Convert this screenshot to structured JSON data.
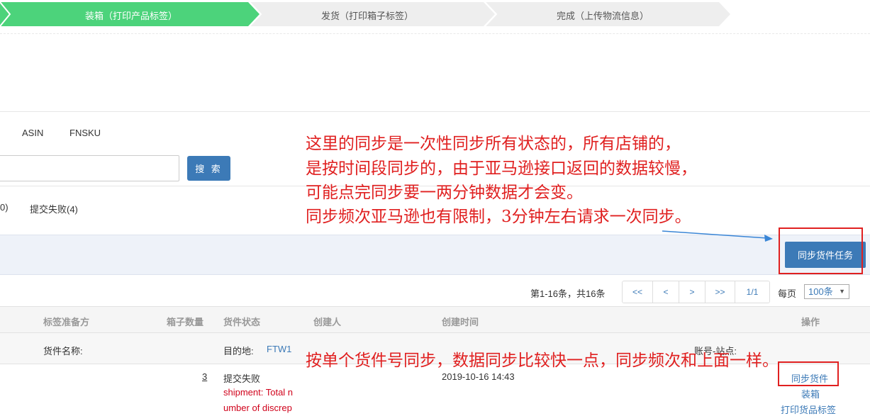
{
  "steps": [
    {
      "label": "装箱（打印产品标签）",
      "active": true
    },
    {
      "label": "发货（打印箱子标签）",
      "active": false
    },
    {
      "label": "完成（上传物流信息）",
      "active": false
    }
  ],
  "filters": {
    "type_tabs": [
      "ASIN",
      "FNSKU"
    ],
    "search_button": "搜 索",
    "status_tabs": [
      "0)",
      "提交失败(4)"
    ]
  },
  "actions": {
    "sync_all_button": "同步货件任务"
  },
  "pagination": {
    "summary": "第1-16条，共16条",
    "buttons": [
      "<<",
      "<",
      ">",
      ">>"
    ],
    "page": "1/1",
    "per_page_label": "每页",
    "per_page_value": "100条"
  },
  "table": {
    "headers": [
      "标签准备方",
      "箱子数量",
      "货件状态",
      "创建人",
      "创建时间",
      "操作"
    ],
    "group": {
      "name_label": "货件名称:",
      "dest_label": "目的地:",
      "dest_value": "FTW1",
      "account_label": "账号-站点:"
    },
    "row": {
      "box_count": "3",
      "status": "提交失败",
      "error_line1": "shipment: Total n",
      "error_line2": "umber of discrep",
      "created_time": "2019-10-16 14:43",
      "ops": [
        "同步货件",
        "装箱",
        "打印货品标签"
      ]
    }
  },
  "annotations": {
    "top_note": [
      "这里的同步是一次性同步所有状态的，所有店铺的，",
      "是按时间段同步的，由于亚马逊接口返回的数据较慢，",
      "可能点完同步要一两分钟数据才会变。",
      "同步频次亚马逊也有限制，3分钟左右请求一次同步。"
    ],
    "row_note": "按单个货件号同步，数据同步比较快一点，同步频次和上面一样。"
  },
  "colors": {
    "step_active": "#4cd37b",
    "step_inactive": "#eeeeee",
    "primary": "#3c7ab7",
    "annotation": "#e02020"
  }
}
